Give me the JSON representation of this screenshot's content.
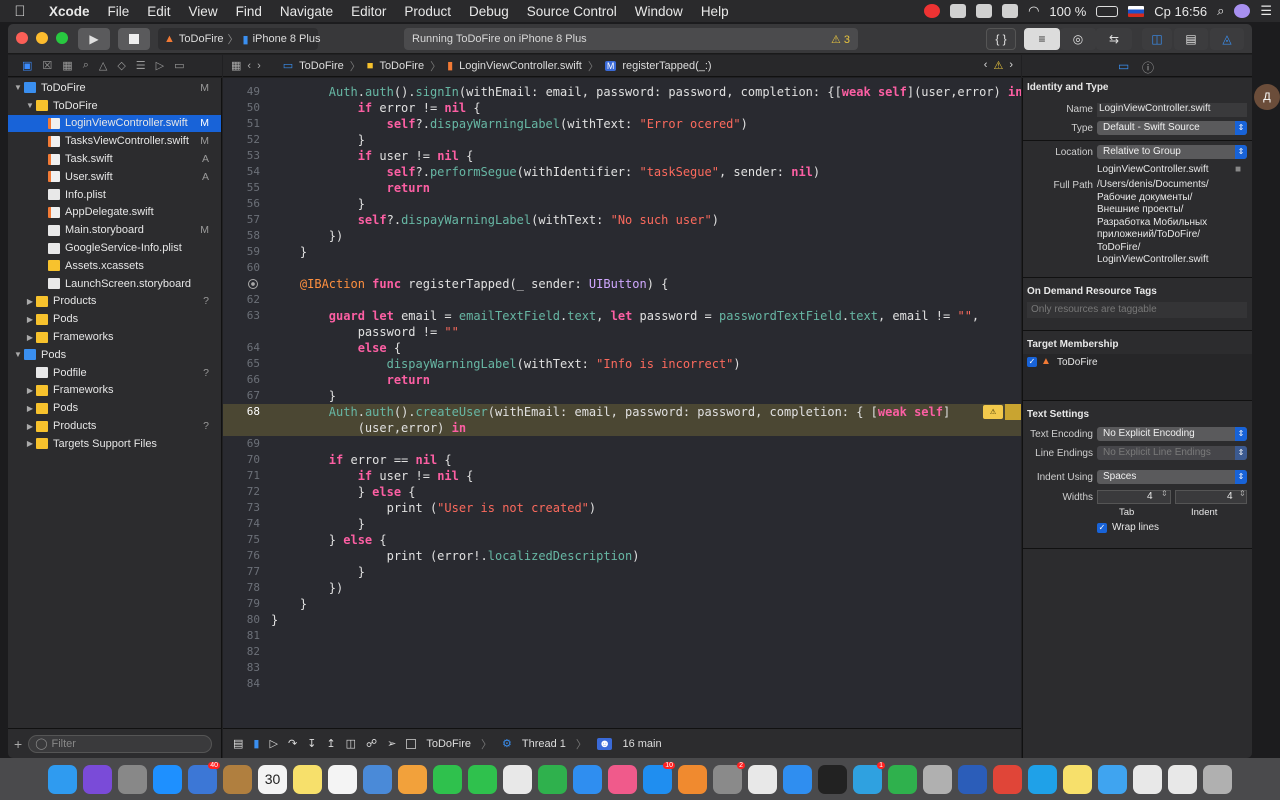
{
  "menubar": {
    "app": "Xcode",
    "items": [
      "File",
      "Edit",
      "View",
      "Find",
      "Navigate",
      "Editor",
      "Product",
      "Debug",
      "Source Control",
      "Window",
      "Help"
    ],
    "battery": "100 %",
    "clock": "Ср 16:56"
  },
  "toolbar": {
    "scheme": "ToDoFire",
    "device": "iPhone 8 Plus",
    "status": "Running ToDoFire on iPhone 8 Plus",
    "warning_count": "3"
  },
  "navigator": {
    "rows": [
      {
        "label": "ToDoFire",
        "badge": "M",
        "icon": "project",
        "depth": 0,
        "open": true
      },
      {
        "label": "ToDoFire",
        "badge": "",
        "icon": "folder",
        "depth": 1,
        "open": true
      },
      {
        "label": "LoginViewController.swift",
        "badge": "M",
        "icon": "swift",
        "depth": 2,
        "selected": true
      },
      {
        "label": "TasksViewController.swift",
        "badge": "M",
        "icon": "swift",
        "depth": 2
      },
      {
        "label": "Task.swift",
        "badge": "A",
        "icon": "swift",
        "depth": 2
      },
      {
        "label": "User.swift",
        "badge": "A",
        "icon": "swift",
        "depth": 2
      },
      {
        "label": "Info.plist",
        "badge": "",
        "icon": "doc",
        "depth": 2
      },
      {
        "label": "AppDelegate.swift",
        "badge": "",
        "icon": "swift",
        "depth": 2
      },
      {
        "label": "Main.storyboard",
        "badge": "M",
        "icon": "doc",
        "depth": 2
      },
      {
        "label": "GoogleService-Info.plist",
        "badge": "",
        "icon": "doc",
        "depth": 2
      },
      {
        "label": "Assets.xcassets",
        "badge": "",
        "icon": "folder",
        "depth": 2
      },
      {
        "label": "LaunchScreen.storyboard",
        "badge": "",
        "icon": "doc",
        "depth": 2
      },
      {
        "label": "Products",
        "badge": "?",
        "icon": "folder",
        "depth": 1,
        "open": false
      },
      {
        "label": "Pods",
        "badge": "",
        "icon": "folder",
        "depth": 1,
        "open": false
      },
      {
        "label": "Frameworks",
        "badge": "",
        "icon": "folder",
        "depth": 1,
        "open": false
      },
      {
        "label": "Pods",
        "badge": "",
        "icon": "project",
        "depth": 0,
        "open": true
      },
      {
        "label": "Podfile",
        "badge": "?",
        "icon": "doc",
        "depth": 1
      },
      {
        "label": "Frameworks",
        "badge": "",
        "icon": "folder",
        "depth": 1,
        "open": false
      },
      {
        "label": "Pods",
        "badge": "",
        "icon": "folder",
        "depth": 1,
        "open": false
      },
      {
        "label": "Products",
        "badge": "?",
        "icon": "folder",
        "depth": 1,
        "open": false
      },
      {
        "label": "Targets Support Files",
        "badge": "",
        "icon": "folder",
        "depth": 1,
        "open": false
      }
    ],
    "filter_placeholder": "Filter"
  },
  "jumpbar": {
    "crumbs": [
      "ToDoFire",
      "ToDoFire",
      "LoginViewController.swift",
      "registerTapped(_:)"
    ]
  },
  "editor": {
    "current_line": "68",
    "lines": [
      {
        "n": "49",
        "t": "        Auth.auth().signIn(withEmail: email, password: password, completion: {[weak self](user,error) in"
      },
      {
        "n": "50",
        "t": "            if error != nil {"
      },
      {
        "n": "51",
        "t": "                self?.dispayWarningLabel(withText: \"Error ocered\")"
      },
      {
        "n": "52",
        "t": "            }"
      },
      {
        "n": "53",
        "t": "            if user != nil {"
      },
      {
        "n": "54",
        "t": "                self?.performSegue(withIdentifier: \"taskSegue\", sender: nil)"
      },
      {
        "n": "55",
        "t": "                return"
      },
      {
        "n": "56",
        "t": "            }"
      },
      {
        "n": "57",
        "t": "            self?.dispayWarningLabel(withText: \"No such user\")"
      },
      {
        "n": "58",
        "t": "        })"
      },
      {
        "n": "59",
        "t": "    }"
      },
      {
        "n": "60",
        "t": ""
      },
      {
        "n": "",
        "t": "    @IBAction func registerTapped(_ sender: UIButton) {"
      },
      {
        "n": "62",
        "t": ""
      },
      {
        "n": "63",
        "t": "        guard let email = emailTextField.text, let password = passwordTextField.text, email != \"\","
      },
      {
        "n": "",
        "t": "            password != \"\""
      },
      {
        "n": "64",
        "t": "            else {"
      },
      {
        "n": "65",
        "t": "                dispayWarningLabel(withText: \"Info is incorrect\")"
      },
      {
        "n": "66",
        "t": "                return"
      },
      {
        "n": "67",
        "t": "        }"
      },
      {
        "n": "68",
        "t": "        Auth.auth().createUser(withEmail: email, password: password, completion: { [weak self]"
      },
      {
        "n": "",
        "t": "            (user,error) in"
      },
      {
        "n": "69",
        "t": ""
      },
      {
        "n": "70",
        "t": "        if error == nil {"
      },
      {
        "n": "71",
        "t": "            if user != nil {"
      },
      {
        "n": "72",
        "t": "            } else {"
      },
      {
        "n": "73",
        "t": "                print (\"User is not created\")"
      },
      {
        "n": "74",
        "t": "            }"
      },
      {
        "n": "75",
        "t": "        } else {"
      },
      {
        "n": "76",
        "t": "                print (error!.localizedDescription)"
      },
      {
        "n": "77",
        "t": "            }"
      },
      {
        "n": "78",
        "t": "        })"
      },
      {
        "n": "79",
        "t": "    }"
      },
      {
        "n": "80",
        "t": "}"
      },
      {
        "n": "81",
        "t": ""
      },
      {
        "n": "82",
        "t": ""
      },
      {
        "n": "83",
        "t": ""
      },
      {
        "n": "84",
        "t": ""
      }
    ]
  },
  "debugbar": {
    "target": "ToDoFire",
    "thread": "Thread 1",
    "frame": "16 main"
  },
  "inspector": {
    "identity_title": "Identity and Type",
    "name_label": "Name",
    "name_value": "LoginViewController.swift",
    "type_label": "Type",
    "type_value": "Default - Swift Source",
    "location_label": "Location",
    "location_value": "Relative to Group",
    "location_file": "LoginViewController.swift",
    "fullpath_label": "Full Path",
    "fullpath_lines": [
      "/Users/denis/Documents/",
      "Рабочие документы/",
      "Внешние проекты/",
      "Разработка Мобильных",
      "приложений/ToDoFire/",
      "ToDoFire/",
      "LoginViewController.swift"
    ],
    "ondemand_title": "On Demand Resource Tags",
    "ondemand_placeholder": "Only resources are taggable",
    "membership_title": "Target Membership",
    "membership_target": "ToDoFire",
    "text_settings_title": "Text Settings",
    "encoding_label": "Text Encoding",
    "encoding_value": "No Explicit Encoding",
    "line_endings_label": "Line Endings",
    "line_endings_value": "No Explicit Line Endings",
    "indent_using_label": "Indent Using",
    "indent_using_value": "Spaces",
    "widths_label": "Widths",
    "tab_value": "4",
    "indent_value": "4",
    "tab_label": "Tab",
    "indent_label": "Indent",
    "wrap_label": "Wrap lines"
  },
  "dock": {
    "calendar_day": "30",
    "icons": [
      {
        "name": "finder-icon",
        "color": "#2f9bf0"
      },
      {
        "name": "siri-icon",
        "color": "#7a4bd8"
      },
      {
        "name": "launchpad-icon",
        "color": "#888888"
      },
      {
        "name": "safari-icon",
        "color": "#1e90ff"
      },
      {
        "name": "photo-booth-icon",
        "color": "#3c77d6",
        "badge": "40"
      },
      {
        "name": "notes-brown-icon",
        "color": "#b07f3f"
      },
      {
        "name": "calendar-icon",
        "color": "#f4f4f4"
      },
      {
        "name": "notes-icon",
        "color": "#f7e06b"
      },
      {
        "name": "reminders-icon",
        "color": "#f4f4f4"
      },
      {
        "name": "preview-icon",
        "color": "#4a8ad8"
      },
      {
        "name": "photos-icon",
        "color": "#f2a13b"
      },
      {
        "name": "messages-icon",
        "color": "#2fc14d"
      },
      {
        "name": "facetime-icon",
        "color": "#2fc14d"
      },
      {
        "name": "textedit-icon",
        "color": "#e8e8e8"
      },
      {
        "name": "numbers-icon",
        "color": "#2fb14d"
      },
      {
        "name": "keynote-icon",
        "color": "#2f8ef0"
      },
      {
        "name": "itunes-icon",
        "color": "#f05a8b"
      },
      {
        "name": "app-store-icon",
        "color": "#1f8ef0",
        "badge": "10"
      },
      {
        "name": "ibooks-icon",
        "color": "#f08a2f"
      },
      {
        "name": "system-preferences-icon",
        "color": "#8a8a8a",
        "badge": "2"
      },
      {
        "name": "chrome-icon",
        "color": "#e8e8e8"
      },
      {
        "name": "xcode-icon",
        "color": "#2f8ef0"
      },
      {
        "name": "terminal-icon",
        "color": "#222222"
      },
      {
        "name": "telegram-icon",
        "color": "#2fa1e0",
        "badge": "1"
      },
      {
        "name": "evernote-icon",
        "color": "#2fb14d"
      },
      {
        "name": "image-capture-icon",
        "color": "#b0b0b0"
      },
      {
        "name": "word-icon",
        "color": "#2b5db9"
      },
      {
        "name": "todoist-icon",
        "color": "#e04538"
      },
      {
        "name": "skype-icon",
        "color": "#1fa1e8"
      },
      {
        "name": "stickies-icon",
        "color": "#f7e06b"
      },
      {
        "name": "folder-icon",
        "color": "#3fa4f0"
      },
      {
        "name": "downloads-icon",
        "color": "#e8e8e8"
      },
      {
        "name": "documents-icon",
        "color": "#e8e8e8"
      },
      {
        "name": "trash-icon",
        "color": "#b0b0b0"
      }
    ]
  }
}
